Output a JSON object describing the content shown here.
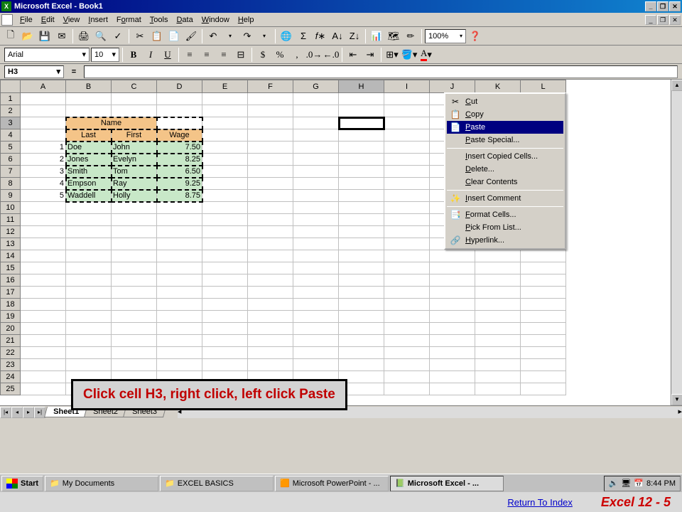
{
  "window": {
    "title": "Microsoft Excel - Book1"
  },
  "menu": {
    "items": [
      "File",
      "Edit",
      "View",
      "Insert",
      "Format",
      "Tools",
      "Data",
      "Window",
      "Help"
    ]
  },
  "toolbar": {
    "zoom": "100%"
  },
  "format": {
    "font_name": "Arial",
    "font_size": "10"
  },
  "namebox": {
    "ref": "H3",
    "eq": "="
  },
  "columns": [
    "A",
    "B",
    "C",
    "D",
    "E",
    "F",
    "G",
    "H",
    "I",
    "J",
    "K",
    "L"
  ],
  "row_count": 25,
  "headers": {
    "name_merged": "Name",
    "last": "Last",
    "first": "First",
    "wage": "Wage"
  },
  "data_rows": [
    {
      "n": "1",
      "last": "Doe",
      "first": "John",
      "wage": "7.50"
    },
    {
      "n": "2",
      "last": "Jones",
      "first": "Evelyn",
      "wage": "8.25"
    },
    {
      "n": "3",
      "last": "Smith",
      "first": "Tom",
      "wage": "6.50"
    },
    {
      "n": "4",
      "last": "Empson",
      "first": "Ray",
      "wage": "9.25"
    },
    {
      "n": "5",
      "last": "Waddell",
      "first": "Holly",
      "wage": "8.75"
    }
  ],
  "context_menu": {
    "items": [
      {
        "icon": "✂",
        "label": "Cut"
      },
      {
        "icon": "📋",
        "label": "Copy"
      },
      {
        "icon": "📄",
        "label": "Paste",
        "highlight": true
      },
      {
        "icon": "",
        "label": "Paste Special..."
      },
      {
        "sep": true
      },
      {
        "icon": "",
        "label": "Insert Copied Cells..."
      },
      {
        "icon": "",
        "label": "Delete..."
      },
      {
        "icon": "",
        "label": "Clear Contents"
      },
      {
        "sep": true
      },
      {
        "icon": "✨",
        "label": "Insert Comment"
      },
      {
        "sep": true
      },
      {
        "icon": "📑",
        "label": "Format Cells..."
      },
      {
        "icon": "",
        "label": "Pick From List..."
      },
      {
        "icon": "🔗",
        "label": "Hyperlink..."
      }
    ]
  },
  "callout": {
    "text": "Click cell H3, right click, left click Paste"
  },
  "sheets": {
    "tabs": [
      "Sheet1",
      "Sheet2",
      "Sheet3"
    ],
    "active": 0
  },
  "taskbar": {
    "start": "Start",
    "tasks": [
      {
        "icon": "📁",
        "label": "My Documents"
      },
      {
        "icon": "📁",
        "label": "EXCEL BASICS"
      },
      {
        "icon": "🟧",
        "label": "Microsoft PowerPoint - ..."
      },
      {
        "icon": "📗",
        "label": "Microsoft Excel - ...",
        "active": true
      }
    ],
    "clock": "8:44 PM"
  },
  "footer": {
    "link": "Return To Index",
    "slide": "Excel 12 -  5"
  }
}
